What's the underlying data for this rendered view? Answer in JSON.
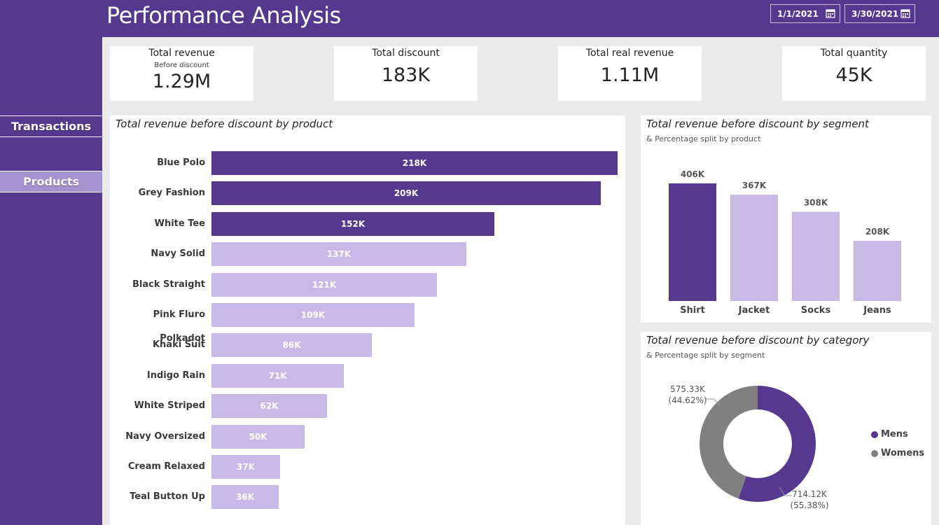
{
  "header": {
    "title": "Performance Analysis",
    "date_start": "1/1/2021",
    "date_end": "3/30/2021"
  },
  "nav": {
    "transactions": "Transactions",
    "products": "Products"
  },
  "kpis": [
    {
      "label": "Total revenue",
      "sub": "Before discount",
      "value": "1.29M"
    },
    {
      "label": "Total discount",
      "value": "183K"
    },
    {
      "label": "Total real revenue",
      "value": "1.11M"
    },
    {
      "label": "Total quantity",
      "value": "45K"
    }
  ],
  "colors": {
    "primary": "#57388f",
    "light": "#c8b9e6",
    "grey": "#808080"
  },
  "chart_data": [
    {
      "type": "bar",
      "orientation": "horizontal",
      "title": "Total revenue before discount by product",
      "categories": [
        "Blue Polo",
        "Grey Fashion",
        "White Tee",
        "Navy Solid",
        "Black Straight",
        "Pink Fluro Polkadot",
        "Khaki Suit",
        "Indigo Rain",
        "White Striped",
        "Navy Oversized",
        "Cream Relaxed",
        "Teal Button Up"
      ],
      "values": [
        218,
        209,
        152,
        137,
        121,
        109,
        86,
        71,
        62,
        50,
        37,
        36
      ],
      "labels": [
        "218K",
        "209K",
        "152K",
        "137K",
        "121K",
        "109K",
        "86K",
        "71K",
        "62K",
        "50K",
        "37K",
        "36K"
      ],
      "highlighted": [
        true,
        true,
        true,
        false,
        false,
        false,
        false,
        false,
        false,
        false,
        false,
        false
      ],
      "unit": "K",
      "xlim": [
        0,
        218
      ]
    },
    {
      "type": "bar",
      "title": "Total revenue before discount by segment",
      "subtitle": "& Percentage split by product",
      "categories": [
        "Shirt",
        "Jacket",
        "Socks",
        "Jeans"
      ],
      "values": [
        406,
        367,
        308,
        208
      ],
      "labels": [
        "406K",
        "367K",
        "308K",
        "208K"
      ],
      "highlighted": [
        true,
        false,
        false,
        false
      ],
      "unit": "K",
      "ylim": [
        0,
        406
      ]
    },
    {
      "type": "pie",
      "title": "Total revenue before discount by category",
      "subtitle": "& Percentage split by segment",
      "slices": [
        {
          "name": "Mens",
          "value": 714.12,
          "label": "714.12K",
          "percent": "(55.38%)",
          "color": "#57388f"
        },
        {
          "name": "Womens",
          "value": 575.33,
          "label": "575.33K",
          "percent": "(44.62%)",
          "color": "#808080"
        }
      ],
      "legend": [
        "Mens",
        "Womens"
      ]
    }
  ]
}
